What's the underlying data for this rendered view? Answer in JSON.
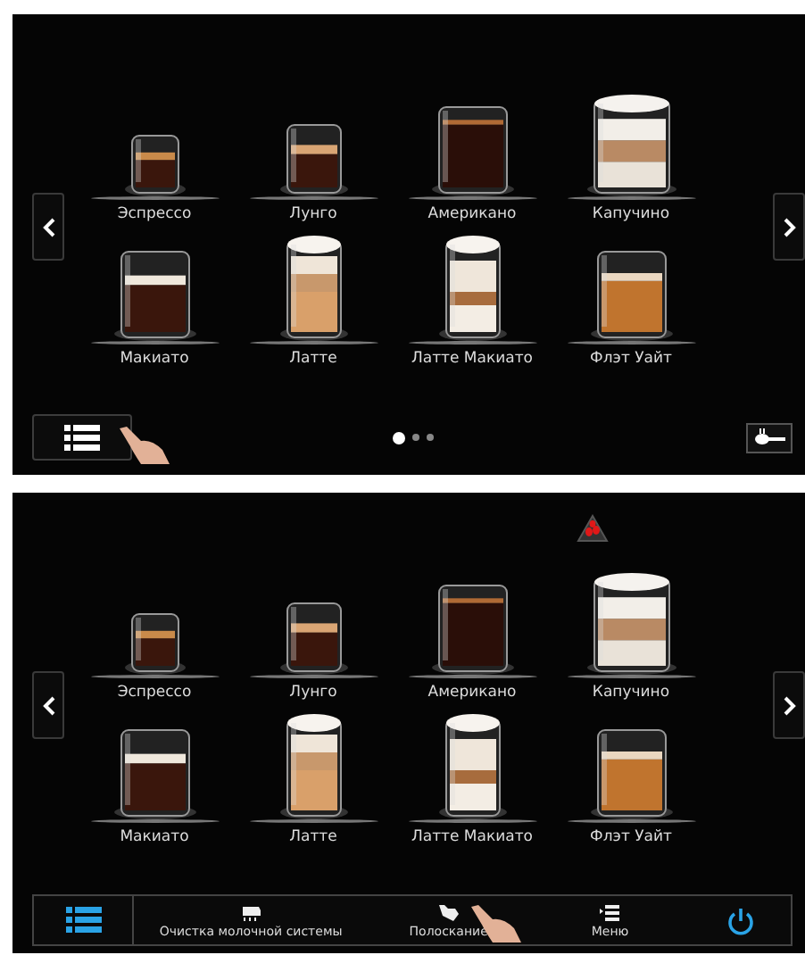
{
  "screens": [
    {
      "drinks": [
        {
          "label": "Эспрессо"
        },
        {
          "label": "Лунго"
        },
        {
          "label": "Американо"
        },
        {
          "label": "Капучино"
        },
        {
          "label": "Макиато"
        },
        {
          "label": "Латте"
        },
        {
          "label": "Латте Макиато"
        },
        {
          "label": "Флэт Уайт"
        }
      ],
      "bottom": {
        "kind": "compact",
        "list_touched": true,
        "dots": [
          {
            "selected": true
          },
          {
            "selected": false
          },
          {
            "selected": false
          }
        ]
      }
    },
    {
      "bean_alert": true,
      "drinks": [
        {
          "label": "Эспрессо"
        },
        {
          "label": "Лунго"
        },
        {
          "label": "Американо"
        },
        {
          "label": "Капучино"
        },
        {
          "label": "Макиато"
        },
        {
          "label": "Латте"
        },
        {
          "label": "Латте Макиато"
        },
        {
          "label": "Флэт Уайт"
        }
      ],
      "bottom": {
        "kind": "bar",
        "items": [
          {
            "label": "Очистка молочной системы",
            "touched": false
          },
          {
            "label": "Полоскание",
            "touched": true
          },
          {
            "label": "Меню",
            "touched": false
          }
        ]
      }
    }
  ]
}
